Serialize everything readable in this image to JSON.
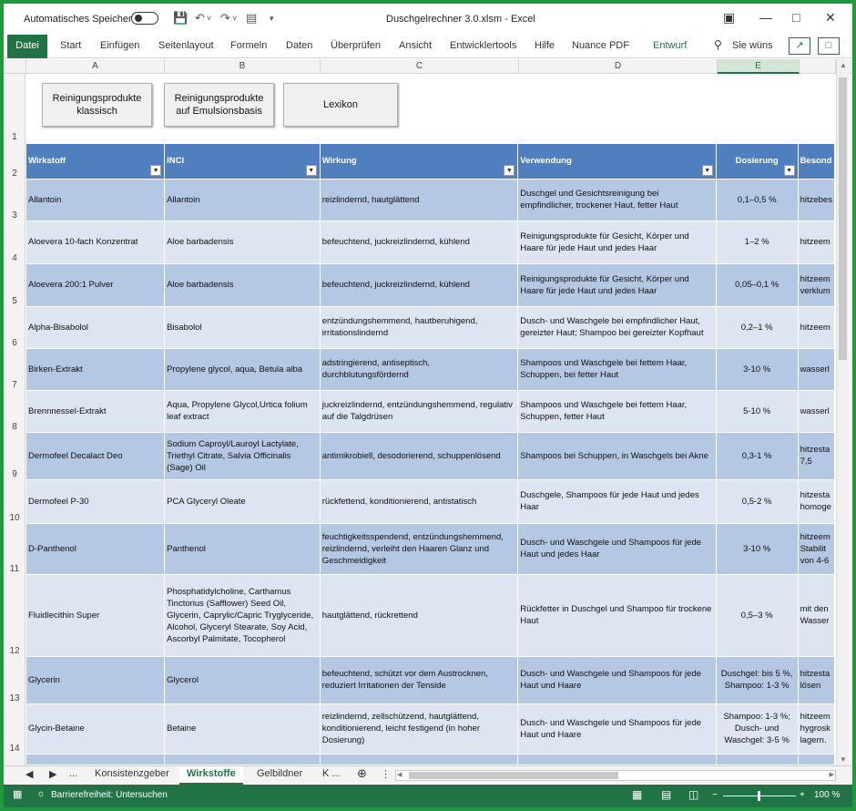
{
  "titlebar": {
    "autosave_label": "Automatisches Speichern",
    "doc_title": "Duschgelrechner 3.0.xlsm  -  Excel"
  },
  "ribbon": {
    "tabs": [
      "Datei",
      "Start",
      "Einfügen",
      "Seitenlayout",
      "Formeln",
      "Daten",
      "Überprüfen",
      "Ansicht",
      "Entwicklertools",
      "Hilfe",
      "Nuance PDF",
      "Entwurf"
    ],
    "search_placeholder": "Sie wüns"
  },
  "columns": [
    "A",
    "B",
    "C",
    "D",
    "E"
  ],
  "selected_column": "E",
  "buttons": [
    {
      "label": "Reinigungsprodukte klassisch"
    },
    {
      "label": "Reinigungsprodukte auf Emulsionsbasis"
    },
    {
      "label": "Lexikon"
    }
  ],
  "table": {
    "headers": [
      "Wirkstoff",
      "INCI",
      "Wirkung",
      "Verwendung",
      "Dosierung",
      "Besond"
    ],
    "rows": [
      {
        "num": "3",
        "cells": [
          "Allantoin",
          "Allantoin",
          "reizlindernd, hautglättend",
          "Duschgel und Gesichtsreinigung bei empfindlicher, trockener Haut, fetter Haut",
          "0,1–0,5 %",
          "hitzebes"
        ]
      },
      {
        "num": "4",
        "cells": [
          "Aloevera 10-fach Konzentrat",
          "Aloe barbadensis",
          "befeuchtend, juckreizlindernd, kühlend",
          "Reinigungsprodukte für Gesicht, Körper und Haare für jede Haut und jedes Haar",
          "1–2 %",
          "hitzeem"
        ]
      },
      {
        "num": "5",
        "cells": [
          "Aloevera 200:1 Pulver",
          "Aloe barbadensis",
          "befeuchtend, juckreizlindernd, kühlend",
          "Reinigungsprodukte für Gesicht, Körper und Haare für jede Haut und jedes Haar",
          "0,05–0,1 %",
          "hitzeem verklum"
        ]
      },
      {
        "num": "6",
        "cells": [
          "Alpha-Bisabolol",
          "Bisabolol",
          "entzündungshemmend, hautberuhigend, irritationslindernd",
          "Dusch- und Waschgele bei empfindlicher Haut, gereizter Haut; Shampoo bei gereizter Kopfhaut",
          "0,2–1 %",
          "hitzeem"
        ]
      },
      {
        "num": "7",
        "cells": [
          "Birken-Extrakt",
          "Propylene glycol, aqua, Betula alba",
          "adstringierend, antiseptisch, durchblutungsfördernd",
          "Shampoos und Waschgele bei fettem Haar, Schuppen, bei fetter Haut",
          "3-10 %",
          "wasserl"
        ]
      },
      {
        "num": "8",
        "cells": [
          "Brennnessel-Extrakt",
          "Aqua, Propylene Glycol,Urtica folium leaf extract",
          "juckreizlindernd, entzündungshemmend, regulativ auf die Talgdrüsen",
          "Shampoos und Waschgele bei fettem Haar, Schuppen, fetter Haut",
          "5-10 %",
          "wasserl"
        ]
      },
      {
        "num": "9",
        "cells": [
          "Dermofeel Decalact Deo",
          "Sodium Caproyl/Lauroyl Lactylate, Triethyl Citrate, Salvia Officinalis (Sage) Oil",
          "antimikrobiell, desodorierend, schuppenlösend",
          "Shampoos bei Schuppen, in Waschgels bei Akne",
          "0,3-1 %",
          "hitzesta 7,5"
        ]
      },
      {
        "num": "10",
        "cells": [
          "Dermofeel P-30",
          "PCA Glyceryl Oleate",
          "rückfettend, konditionierend, antistatisch",
          "Duschgele, Shampoos für jede Haut und jedes Haar",
          "0,5-2 %",
          "hitzesta homoge"
        ]
      },
      {
        "num": "11",
        "cells": [
          "D-Panthenol",
          "Panthenol",
          "feuchtigkeitsspendend, entzündungshemmend, reizlindernd, verleiht den Haaren Glanz und Geschmeidigkeit",
          "Dusch- und Waschgele und Shampoos für jede Haut und jedes Haar",
          "3-10 %",
          "hitzeem Stabilit von 4-6"
        ]
      },
      {
        "num": "12",
        "cells": [
          "Fluidlecithin Super",
          "Phosphatidylcholine, Carthamus Tinctorius (Safflower) Seed Oil, Glycerin, Caprylic/Capric Tryglyceride, Alcohol, Glyceryl Stearate, Soy Acid, Ascorbyl Palmitate, Tocopherol",
          "hautglättend, rückrettend",
          "Rückfetter in Duschgel und Shampoo für trockene Haut",
          "0,5–3 %",
          "mit den Wasser"
        ]
      },
      {
        "num": "13",
        "cells": [
          "Glycerin",
          "Glycerol",
          "befeuchtend, schützt vor dem Austrocknen, reduziert Irritationen der Tenside",
          "Dusch- und Waschgele und Shampoos für jede Haut und Haare",
          "Duschgel: bis 5 %, Shampoo: 1-3 %",
          "hitzesta lösen"
        ]
      },
      {
        "num": "14",
        "cells": [
          "Glycin-Betaine",
          "Betaine",
          "reizlindernd, zellschützend, hautglättend, konditionierend, leicht festigend (in hoher Dosierung)",
          "Dusch- und Waschgele und Shampoos für jede Haut und Haare",
          "Shampoo: 1-3 %; Dusch- und Waschgel: 3-5 %",
          "hitzeem hygrosk lagern."
        ]
      }
    ]
  },
  "sheet_tabs": {
    "ellipsis_left": "...",
    "tabs": [
      "Konsistenzgeber",
      "Wirkstoffe",
      "Gelbildner",
      "K ..."
    ],
    "active": "Wirkstoffe"
  },
  "status": {
    "accessibility": "Barrierefreiheit: Untersuchen",
    "zoom": "100 %"
  }
}
